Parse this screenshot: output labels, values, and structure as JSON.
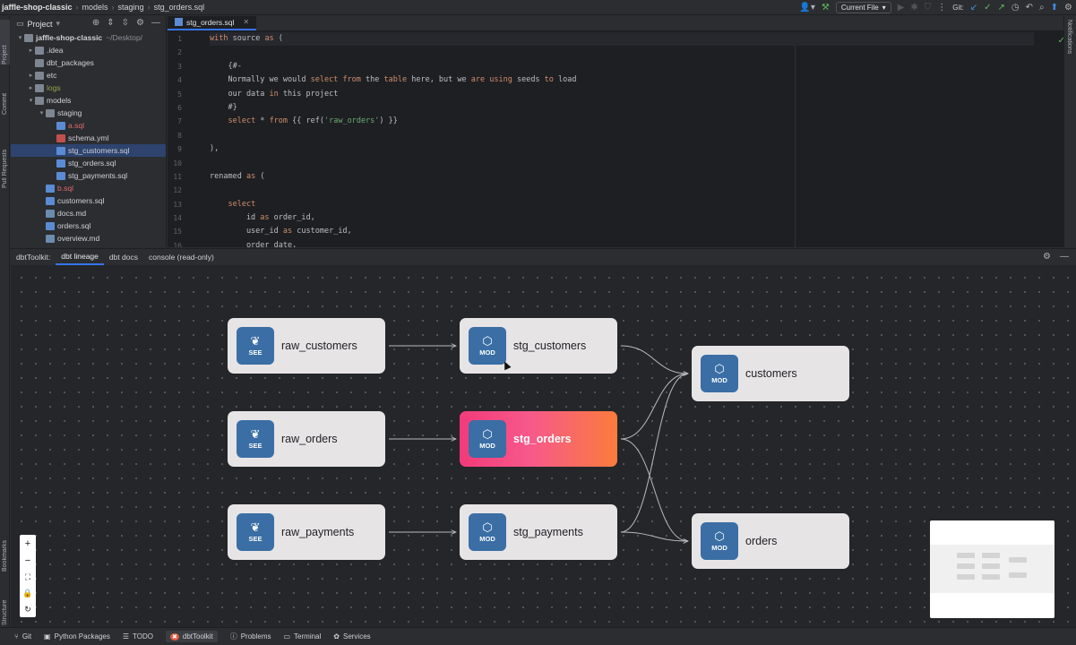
{
  "title_bar": {
    "crumbs": [
      "jaffle-shop-classic",
      "models",
      "staging",
      "stg_orders.sql"
    ],
    "run_config": "Current File",
    "git_label": "Git:"
  },
  "left_strip": {
    "project": "Project",
    "commit": "Commit",
    "pull_requests": "Pull Requests",
    "bookmarks": "Bookmarks",
    "structure": "Structure"
  },
  "right_strip": {
    "notifications": "Notifications"
  },
  "project_panel": {
    "header": "Project",
    "items": [
      {
        "label": "jaffle-shop-classic",
        "hint": "~/Desktop/",
        "kind": "folder",
        "depth": 0,
        "open": true,
        "bold": true
      },
      {
        "label": ".idea",
        "kind": "folder",
        "depth": 1,
        "open": false
      },
      {
        "label": "dbt_packages",
        "kind": "folder",
        "depth": 1
      },
      {
        "label": "etc",
        "kind": "folder",
        "depth": 1,
        "open": false
      },
      {
        "label": "logs",
        "kind": "folder",
        "depth": 1,
        "open": false,
        "style": "olive"
      },
      {
        "label": "models",
        "kind": "folder",
        "depth": 1,
        "open": true
      },
      {
        "label": "staging",
        "kind": "folder",
        "depth": 2,
        "open": true
      },
      {
        "label": "a.sql",
        "kind": "sql",
        "depth": 3,
        "style": "red"
      },
      {
        "label": "schema.yml",
        "kind": "yml",
        "depth": 3
      },
      {
        "label": "stg_customers.sql",
        "kind": "sql",
        "depth": 3,
        "selected": true
      },
      {
        "label": "stg_orders.sql",
        "kind": "sql",
        "depth": 3
      },
      {
        "label": "stg_payments.sql",
        "kind": "sql",
        "depth": 3
      },
      {
        "label": "b.sql",
        "kind": "sql",
        "depth": 2,
        "style": "red"
      },
      {
        "label": "customers.sql",
        "kind": "sql",
        "depth": 2
      },
      {
        "label": "docs.md",
        "kind": "md",
        "depth": 2
      },
      {
        "label": "orders.sql",
        "kind": "sql",
        "depth": 2
      },
      {
        "label": "overview.md",
        "kind": "md",
        "depth": 2
      }
    ]
  },
  "editor": {
    "tab": "stg_orders.sql",
    "lines": [
      [
        [
          "kw",
          "with"
        ],
        [
          "t",
          " source "
        ],
        [
          "kw",
          "as"
        ],
        [
          "t",
          " ("
        ]
      ],
      [
        [
          "t",
          ""
        ]
      ],
      [
        [
          "t",
          "    {#-"
        ]
      ],
      [
        [
          "t",
          "    Normally we would "
        ],
        [
          "kw",
          "select"
        ],
        [
          "t",
          " "
        ],
        [
          "kw",
          "from"
        ],
        [
          "t",
          " the "
        ],
        [
          "kw",
          "table"
        ],
        [
          "t",
          " here, but we "
        ],
        [
          "kw",
          "are"
        ],
        [
          "t",
          " "
        ],
        [
          "kw",
          "using"
        ],
        [
          "t",
          " seeds "
        ],
        [
          "kw",
          "to"
        ],
        [
          "t",
          " load"
        ]
      ],
      [
        [
          "t",
          "    our data "
        ],
        [
          "kw",
          "in"
        ],
        [
          "t",
          " this project"
        ]
      ],
      [
        [
          "t",
          "    #}"
        ]
      ],
      [
        [
          "t",
          "    "
        ],
        [
          "kw",
          "select"
        ],
        [
          "t",
          " * "
        ],
        [
          "kw",
          "from"
        ],
        [
          "t",
          " {{ ref("
        ],
        [
          "str",
          "'raw_orders'"
        ],
        [
          "t",
          ") }}"
        ]
      ],
      [
        [
          "t",
          ""
        ]
      ],
      [
        [
          "t",
          "),"
        ]
      ],
      [
        [
          "t",
          ""
        ]
      ],
      [
        [
          "t",
          "renamed "
        ],
        [
          "kw",
          "as"
        ],
        [
          "t",
          " ("
        ]
      ],
      [
        [
          "t",
          ""
        ]
      ],
      [
        [
          "t",
          "    "
        ],
        [
          "kw",
          "select"
        ]
      ],
      [
        [
          "t",
          "        id "
        ],
        [
          "kw",
          "as"
        ],
        [
          "t",
          " order_id,"
        ]
      ],
      [
        [
          "t",
          "        user_id "
        ],
        [
          "kw",
          "as"
        ],
        [
          "t",
          " customer_id,"
        ]
      ],
      [
        [
          "t",
          "        order_date,"
        ]
      ]
    ]
  },
  "panel_tabs": {
    "prefix": "dbtToolkit:",
    "tabs": [
      "dbt lineage",
      "dbt docs",
      "console (read-only)"
    ],
    "active": 0
  },
  "lineage": {
    "nodes": [
      {
        "id": "raw_customers",
        "label": "raw_customers",
        "badge": "SEE"
      },
      {
        "id": "raw_orders",
        "label": "raw_orders",
        "badge": "SEE"
      },
      {
        "id": "raw_payments",
        "label": "raw_payments",
        "badge": "SEE"
      },
      {
        "id": "stg_customers",
        "label": "stg_customers",
        "badge": "MOD"
      },
      {
        "id": "stg_orders",
        "label": "stg_orders",
        "badge": "MOD",
        "active": true
      },
      {
        "id": "stg_payments",
        "label": "stg_payments",
        "badge": "MOD"
      },
      {
        "id": "customers",
        "label": "customers",
        "badge": "MOD"
      },
      {
        "id": "orders",
        "label": "orders",
        "badge": "MOD"
      }
    ],
    "edges": [
      [
        "raw_customers",
        "stg_customers"
      ],
      [
        "raw_orders",
        "stg_orders"
      ],
      [
        "raw_payments",
        "stg_payments"
      ],
      [
        "stg_customers",
        "customers"
      ],
      [
        "stg_orders",
        "customers"
      ],
      [
        "stg_payments",
        "customers"
      ],
      [
        "stg_orders",
        "orders"
      ],
      [
        "stg_payments",
        "orders"
      ]
    ]
  },
  "status_bar": {
    "items": [
      {
        "label": "Git",
        "icon": "git-branch-icon"
      },
      {
        "label": "Python Packages",
        "icon": "package-icon"
      },
      {
        "label": "TODO",
        "icon": "todo-icon"
      },
      {
        "label": "dbtToolkit",
        "icon": "dbt-icon",
        "active": true
      },
      {
        "label": "Problems",
        "icon": "problems-icon"
      },
      {
        "label": "Terminal",
        "icon": "terminal-icon"
      },
      {
        "label": "Services",
        "icon": "services-icon"
      }
    ]
  },
  "colors": {
    "accent": "#3574f0",
    "node_badge": "#3a6ea5",
    "active_node_start": "#f23a7a",
    "active_node_end": "#fb7c3c"
  }
}
